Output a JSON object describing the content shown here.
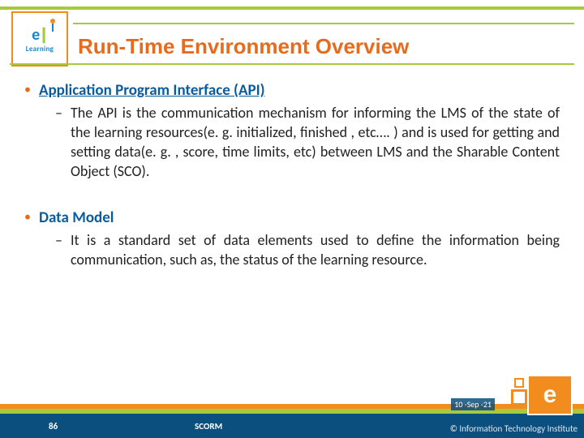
{
  "logo": {
    "brand_letter": "e",
    "brand_text": "Learning"
  },
  "title": "Run-Time Environment Overview",
  "bullets": [
    {
      "heading": "Application Program Interface (API)",
      "underline": true,
      "sub": "The API is the communication mechanism for informing the LMS of the state of the learning resources(e. g. initialized, finished , etc…. ) and is used for getting and setting data(e. g. , score, time limits, etc) between LMS and the Sharable Content Object (SCO)."
    },
    {
      "heading": "Data Model",
      "underline": false,
      "sub": "It is  a standard set of data elements used to define the information being communication, such as, the status of the learning resource."
    }
  ],
  "footer": {
    "page": "86",
    "label": "SCORM",
    "date": "10 -Sep -21",
    "credit_prefix": "©",
    "credit": "Information Technology Institute"
  },
  "right_logo": "e"
}
